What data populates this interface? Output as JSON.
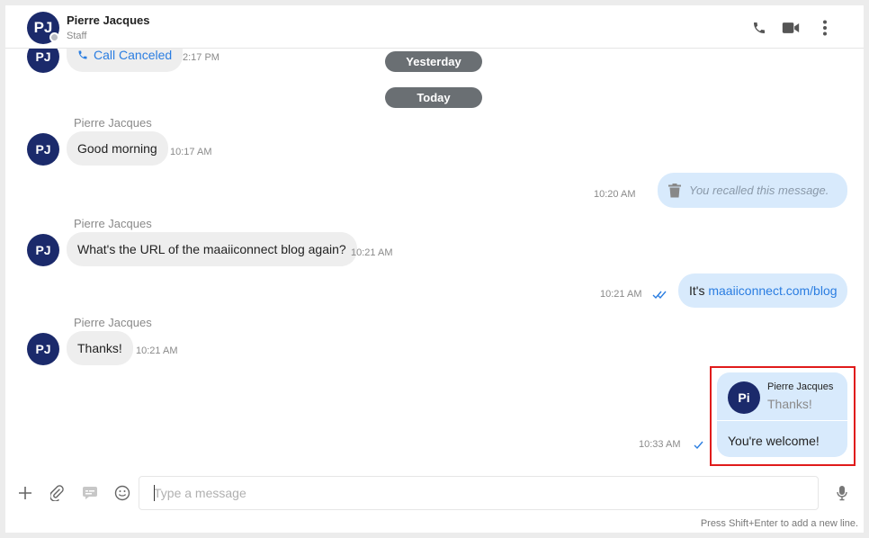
{
  "header": {
    "avatar_initials": "PJ",
    "name": "Pierre Jacques",
    "role": "Staff",
    "icons": [
      "phone-icon",
      "video-icon",
      "more-vertical-icon"
    ]
  },
  "messages": {
    "call": {
      "avatar": "PJ",
      "text": "Call Canceled",
      "time": "2:17 PM"
    },
    "date_yesterday": "Yesterday",
    "date_today": "Today",
    "m1": {
      "sender": "Pierre Jacques",
      "avatar": "PJ",
      "text": "Good morning",
      "time": "10:17 AM"
    },
    "m2": {
      "text": "You recalled this message.",
      "time": "10:20 AM"
    },
    "m3": {
      "sender": "Pierre Jacques",
      "avatar": "PJ",
      "text": "What's the URL of the maaiiconnect blog again?",
      "time": "10:21 AM"
    },
    "m4": {
      "prefix": "It's ",
      "link": "maaiiconnect.com/blog",
      "time": "10:21 AM"
    },
    "m5": {
      "sender": "Pierre Jacques",
      "avatar": "PJ",
      "text": "Thanks!",
      "time": "10:21 AM"
    },
    "m6": {
      "quote_avatar": "Pi",
      "quote_sender": "Pierre Jacques",
      "quote_text": "Thanks!",
      "text": "You're welcome!",
      "time": "10:33 AM"
    }
  },
  "composer": {
    "placeholder": "Type a message",
    "value": "",
    "hint": "Press Shift+Enter to add a new line."
  },
  "colors": {
    "avatar_bg": "#1b2a6b",
    "outgoing_bubble": "#d8eafc",
    "incoming_bubble": "#eeeeee",
    "link": "#2a7de1",
    "date_pill": "#6a6f73",
    "highlight_border": "#e01b1b"
  }
}
